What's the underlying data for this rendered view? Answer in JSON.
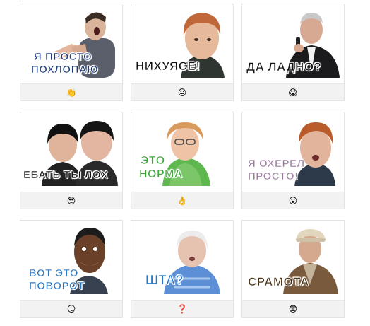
{
  "stickers": [
    {
      "caption_lines": [
        "Я ПРОСТО",
        "ПОХЛОПАЮ"
      ],
      "caption_color": "#1d3a7a",
      "emoji": "👏",
      "emoji_name": "clapping-hands-icon"
    },
    {
      "caption_lines": [
        "НИХУЯСЕ!"
      ],
      "caption_color": "#111111",
      "emoji": "😐",
      "emoji_name": "neutral-face-icon"
    },
    {
      "caption_lines": [
        "ДА ЛАДНО?"
      ],
      "caption_color": "#111111",
      "emoji": "😱",
      "emoji_name": "screaming-face-icon"
    },
    {
      "caption_lines": [
        "ЕБАТЬ ТЫ ЛОХ"
      ],
      "caption_color": "#111111",
      "emoji": "😎",
      "emoji_name": "sunglasses-face-icon"
    },
    {
      "caption_lines": [
        "ЭТО",
        "НОРМА"
      ],
      "caption_color": "#3aa535",
      "emoji": "👌",
      "emoji_name": "ok-hand-icon"
    },
    {
      "caption_lines": [
        "Я ОХЕРЕЛ",
        "ПРОСТО!"
      ],
      "caption_color": "#9b7aa0",
      "emoji": "😮",
      "emoji_name": "surprised-face-icon"
    },
    {
      "caption_lines": [
        "ВОТ ЭТО",
        "ПОВОРОТ"
      ],
      "caption_color": "#2a78c4",
      "emoji": "😏",
      "emoji_name": "smirking-face-icon"
    },
    {
      "caption_lines": [
        "ШТА?"
      ],
      "caption_color": "#2a78c4",
      "emoji": "❓",
      "emoji_name": "question-mark-icon"
    },
    {
      "caption_lines": [
        "СРАМОТА"
      ],
      "caption_color": "#4a3418",
      "emoji": "😨",
      "emoji_name": "fearful-face-icon"
    }
  ]
}
